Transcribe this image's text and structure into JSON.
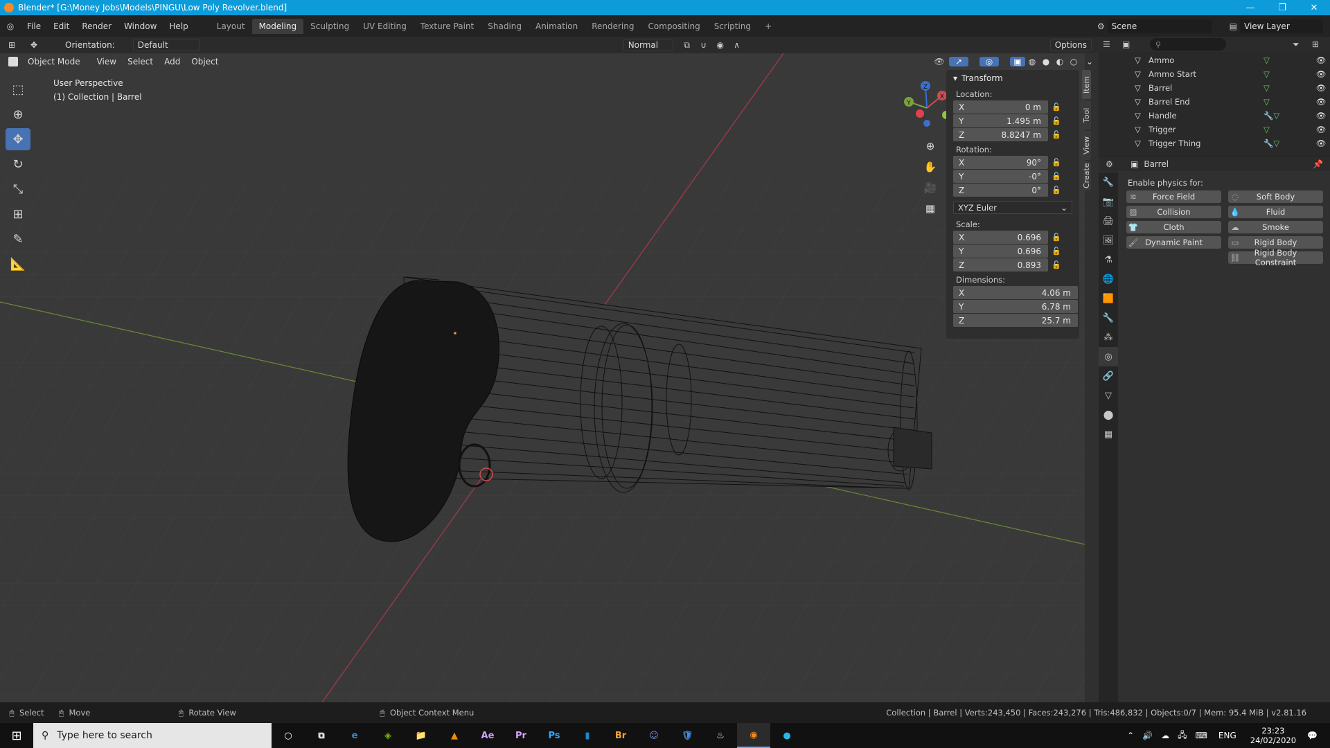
{
  "window": {
    "title": "Blender* [G:\\Money Jobs\\Models\\PINGU\\Low Poly Revolver.blend]"
  },
  "menu": [
    "File",
    "Edit",
    "Render",
    "Window",
    "Help"
  ],
  "workspaces": [
    "Layout",
    "Modeling",
    "Sculpting",
    "UV Editing",
    "Texture Paint",
    "Shading",
    "Animation",
    "Rendering",
    "Compositing",
    "Scripting"
  ],
  "active_workspace": "Modeling",
  "scene": {
    "scene_name": "Scene",
    "view_layer": "View Layer"
  },
  "header": {
    "orientation_label": "Orientation:",
    "orientation_value": "Default",
    "transform_mode": "Normal",
    "options": "Options"
  },
  "viewport_menu": {
    "mode": "Object Mode",
    "items": [
      "View",
      "Select",
      "Add",
      "Object"
    ]
  },
  "viewport_info": {
    "line1": "User Perspective",
    "line2": "(1) Collection | Barrel"
  },
  "transform": {
    "title": "Transform",
    "location_label": "Location:",
    "location": [
      {
        "axis": "X",
        "value": "0 m"
      },
      {
        "axis": "Y",
        "value": "1.495 m"
      },
      {
        "axis": "Z",
        "value": "8.8247 m"
      }
    ],
    "rotation_label": "Rotation:",
    "rotation": [
      {
        "axis": "X",
        "value": "90°"
      },
      {
        "axis": "Y",
        "value": "-0°"
      },
      {
        "axis": "Z",
        "value": "0°"
      }
    ],
    "rotation_mode": "XYZ Euler",
    "scale_label": "Scale:",
    "scale": [
      {
        "axis": "X",
        "value": "0.696"
      },
      {
        "axis": "Y",
        "value": "0.696"
      },
      {
        "axis": "Z",
        "value": "0.893"
      }
    ],
    "dimensions_label": "Dimensions:",
    "dimensions": [
      {
        "axis": "X",
        "value": "4.06 m"
      },
      {
        "axis": "Y",
        "value": "6.78 m"
      },
      {
        "axis": "Z",
        "value": "25.7 m"
      }
    ]
  },
  "side_tabs": [
    "Item",
    "Tool",
    "View",
    "Create"
  ],
  "outliner": [
    {
      "name": "Ammo",
      "mod": false
    },
    {
      "name": "Ammo Start",
      "mod": false
    },
    {
      "name": "Barrel",
      "mod": false
    },
    {
      "name": "Barrel End",
      "mod": false
    },
    {
      "name": "Handle",
      "mod": true
    },
    {
      "name": "Trigger",
      "mod": false
    },
    {
      "name": "Trigger Thing",
      "mod": true
    }
  ],
  "properties": {
    "object_name": "Barrel",
    "physics_label": "Enable physics for:",
    "buttons": [
      "Force Field",
      "Soft Body",
      "Collision",
      "Fluid",
      "Cloth",
      "Smoke",
      "Dynamic Paint",
      "Rigid Body",
      "",
      "Rigid Body Constraint"
    ]
  },
  "statusbar": {
    "select": "Select",
    "move": "Move",
    "rotate": "Rotate View",
    "context": "Object Context Menu",
    "stats": "Collection | Barrel | Verts:243,450 | Faces:243,276 | Tris:486,832 | Objects:0/7 | Mem: 95.4 MiB | v2.81.16"
  },
  "taskbar": {
    "search_placeholder": "Type here to search",
    "apps": [
      "Ae",
      "Pr",
      "Ps",
      "Br"
    ],
    "lang": "ENG",
    "time": "23:23",
    "date": "24/02/2020"
  },
  "gizmo": {
    "x": "X",
    "y": "Y",
    "z": "Z"
  }
}
